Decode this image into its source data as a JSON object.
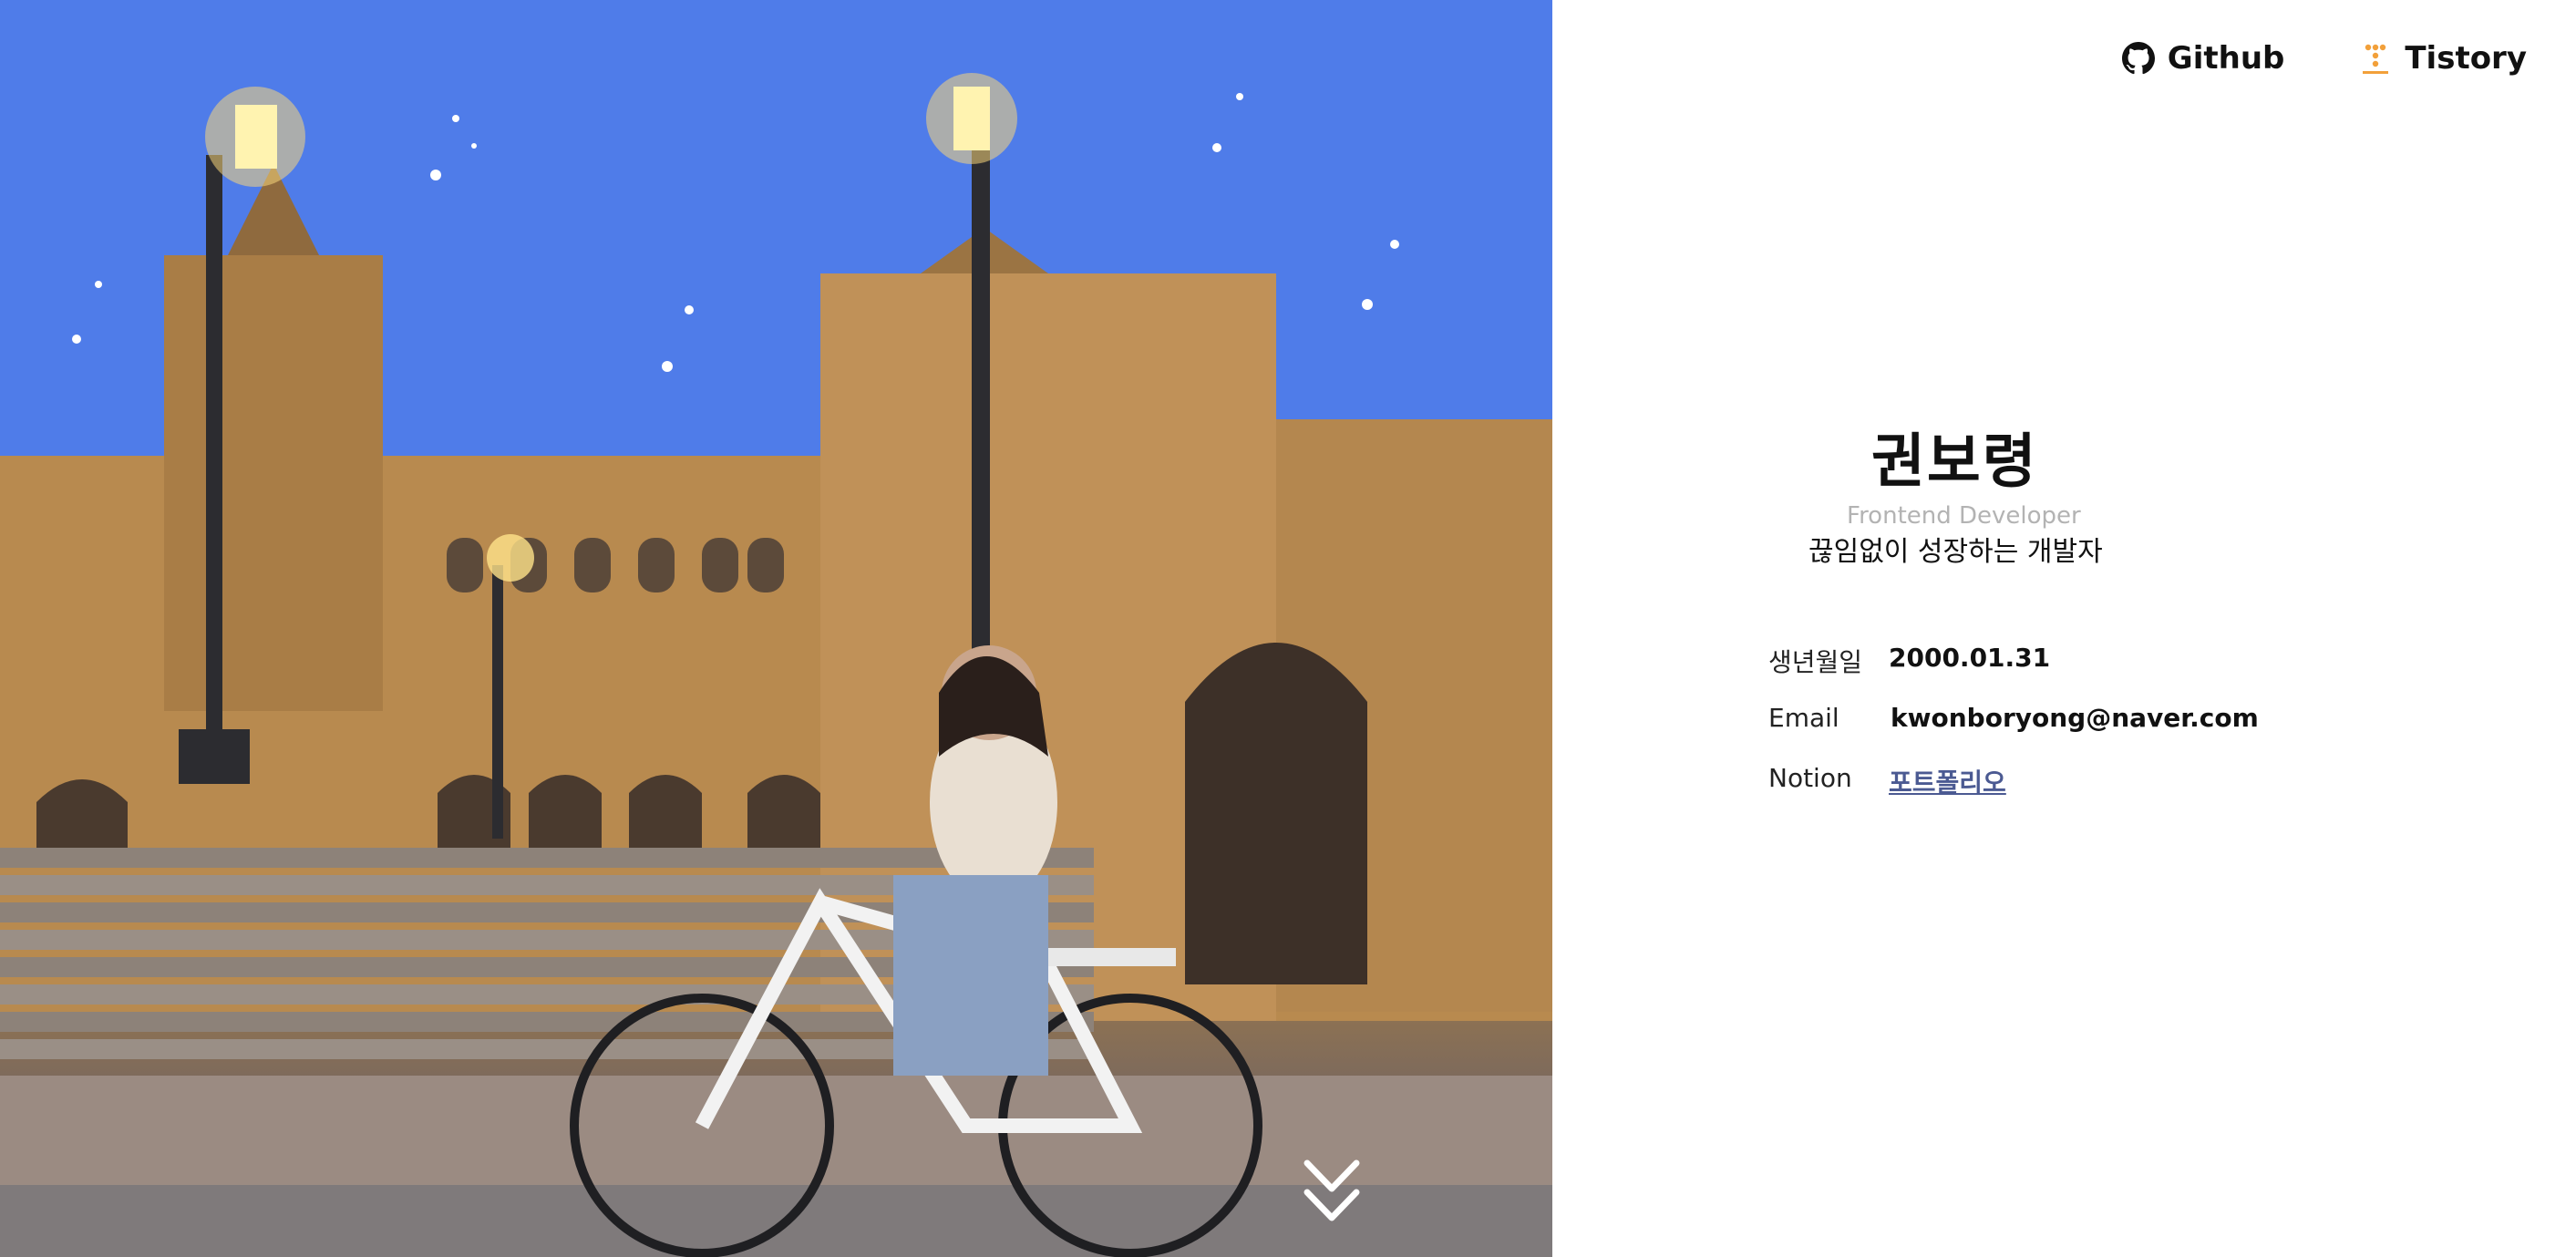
{
  "nav": {
    "links": [
      {
        "label": "Github",
        "icon": "github-icon"
      },
      {
        "label": "Tistory",
        "icon": "tistory-icon"
      }
    ]
  },
  "profile": {
    "name": "권보령",
    "role": "Frontend Developer",
    "tagline": "끊임없이 성장하는 개발자"
  },
  "info": {
    "birth": {
      "label": "생년월일",
      "value": "2000.01.31"
    },
    "email": {
      "label": "Email",
      "value": "kwonboryong@naver.com"
    },
    "notion": {
      "label": "Notion",
      "value": "포트폴리오"
    }
  },
  "hero": {
    "image": "photo of a person riding a white bicycle in front of an ornate plaza building at dusk, street lamps lit, sparkle decorations in the blue sky",
    "scroll_icon": "double-chevron-down-icon"
  },
  "colors": {
    "link": "#4b5a92",
    "muted": "#b3b3b3",
    "text": "#111111",
    "tistory_accent": "#f2a03a"
  }
}
